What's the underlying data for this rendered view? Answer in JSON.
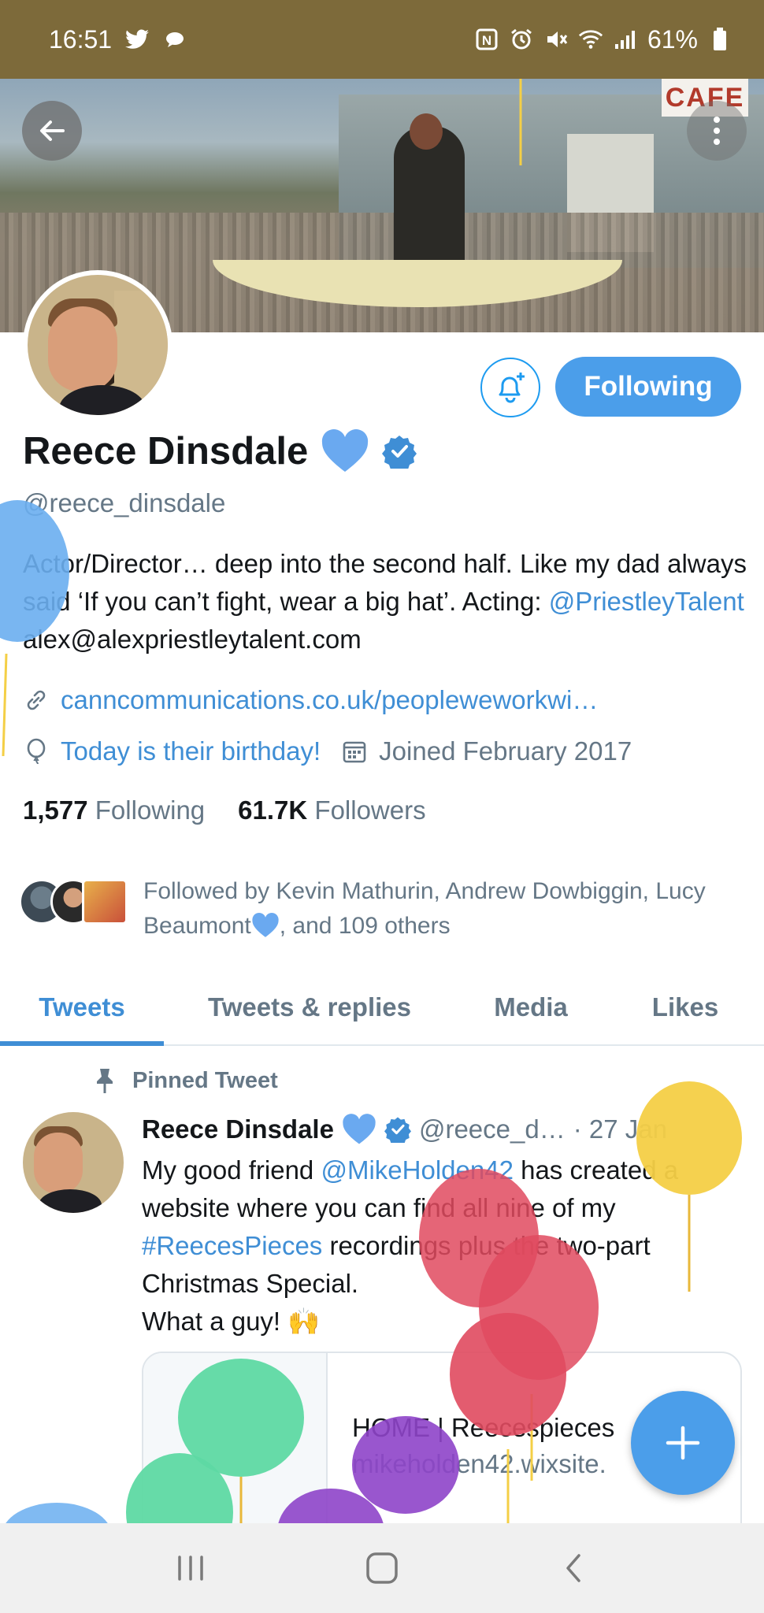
{
  "status_bar": {
    "time": "16:51",
    "battery": "61%",
    "icons": [
      "twitter-icon",
      "chat-bubble-icon",
      "nfc-icon",
      "alarm-icon",
      "mute-icon",
      "wifi-icon",
      "signal-icon",
      "battery-icon"
    ]
  },
  "banner": {
    "sign_text": "CAFE"
  },
  "profile": {
    "name": "Reece Dinsdale",
    "handle": "@reece_dinsdale",
    "bio_part1": "Actor/Director… deep into the second half. Like my dad always said ‘If you can’t fight, wear a big hat’. Acting: ",
    "bio_mention": "@PriestleyTalent",
    "bio_part2": " alex@alexpriestleytalent.com",
    "website": "canncommunications.co.uk/peopleweworkwi…",
    "birthday": "Today is their birthday!",
    "joined": "Joined February 2017",
    "following_count": "1,577",
    "following_label": "Following",
    "followers_count": "61.7K",
    "followers_label": "Followers",
    "followed_by_part1": "Followed by Kevin Mathurin, Andrew Dowbiggin, Lucy Beaumont",
    "followed_by_part2": ", and 109 others"
  },
  "actions": {
    "following_button": "Following"
  },
  "tabs": [
    {
      "label": "Tweets",
      "active": true
    },
    {
      "label": "Tweets & replies",
      "active": false
    },
    {
      "label": "Media",
      "active": false
    },
    {
      "label": "Likes",
      "active": false
    }
  ],
  "tweet": {
    "pinned_label": "Pinned Tweet",
    "author": "Reece Dinsdale",
    "handle": "@reece_d…",
    "date": "· 27 Jan",
    "body_a": "My good friend ",
    "body_mention": "@MikeHolden42",
    "body_b": " has created a website where you can find all nine of my ",
    "body_hashtag": "#ReecesPieces",
    "body_c": " recordings plus the two-part Christmas Special.",
    "body_d": "What a guy! 🙌",
    "card_title": "HOME | Reecespieces",
    "card_url": "mikeholden42.wixsite."
  },
  "colors": {
    "accent": "#4b9eea",
    "status_bar": "#7d6a3a",
    "heart": "#6aa9f0",
    "balloon_red": "#e04a5f",
    "balloon_green": "#5ed9a3",
    "balloon_purple": "#8e44c9",
    "balloon_yellow": "#f4cf46",
    "balloon_blue": "#6aaef0"
  }
}
